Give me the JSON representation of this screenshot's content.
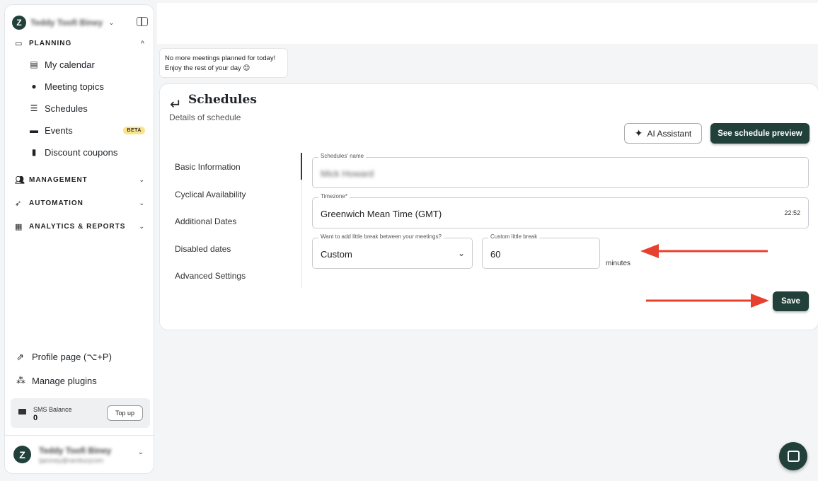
{
  "sidebar": {
    "workspace_name": "Teddy Toofi Biney",
    "sections": {
      "planning": "PLANNING",
      "management": "MANAGEMENT",
      "automation": "AUTOMATION",
      "analytics": "ANALYTICS & REPORTS"
    },
    "planning_items": [
      {
        "label": "My calendar",
        "icon": "calendar-icon"
      },
      {
        "label": "Meeting topics",
        "icon": "chat-icon"
      },
      {
        "label": "Schedules",
        "icon": "list-icon"
      },
      {
        "label": "Events",
        "icon": "ticket-icon",
        "badge": "BETA"
      },
      {
        "label": "Discount coupons",
        "icon": "coupon-icon"
      }
    ],
    "profile_page": "Profile page (⌥+P)",
    "manage_plugins": "Manage plugins",
    "sms": {
      "label": "SMS Balance",
      "value": "0",
      "topup": "Top up"
    },
    "user": {
      "name": "Teddy Toofi Biney",
      "email": "tjaroney@ramburycom"
    }
  },
  "toast": {
    "line1": "No more meetings planned for today!",
    "line2": "Enjoy the rest of your day 😌"
  },
  "page": {
    "title": "Schedules",
    "subtitle": "Details of schedule",
    "ai_button": "AI Assistant",
    "preview_button": "See schedule preview",
    "save_button": "Save"
  },
  "tabs": [
    "Basic Information",
    "Cyclical Availability",
    "Additional Dates",
    "Disabled dates",
    "Advanced Settings"
  ],
  "form": {
    "name_label": "Schedules' name",
    "name_value": "Mick Howard",
    "timezone_label": "Timezone*",
    "timezone_value": "Greenwich Mean Time (GMT)",
    "timezone_time": "22:52",
    "break_label": "Want to add little break between your meetings?",
    "break_value": "Custom",
    "custom_label": "Custom little break",
    "custom_value": "60",
    "unit": "minutes"
  },
  "colors": {
    "accent": "#22403a",
    "arrow": "#e8402f",
    "beta_badge": "#fbe38b"
  }
}
